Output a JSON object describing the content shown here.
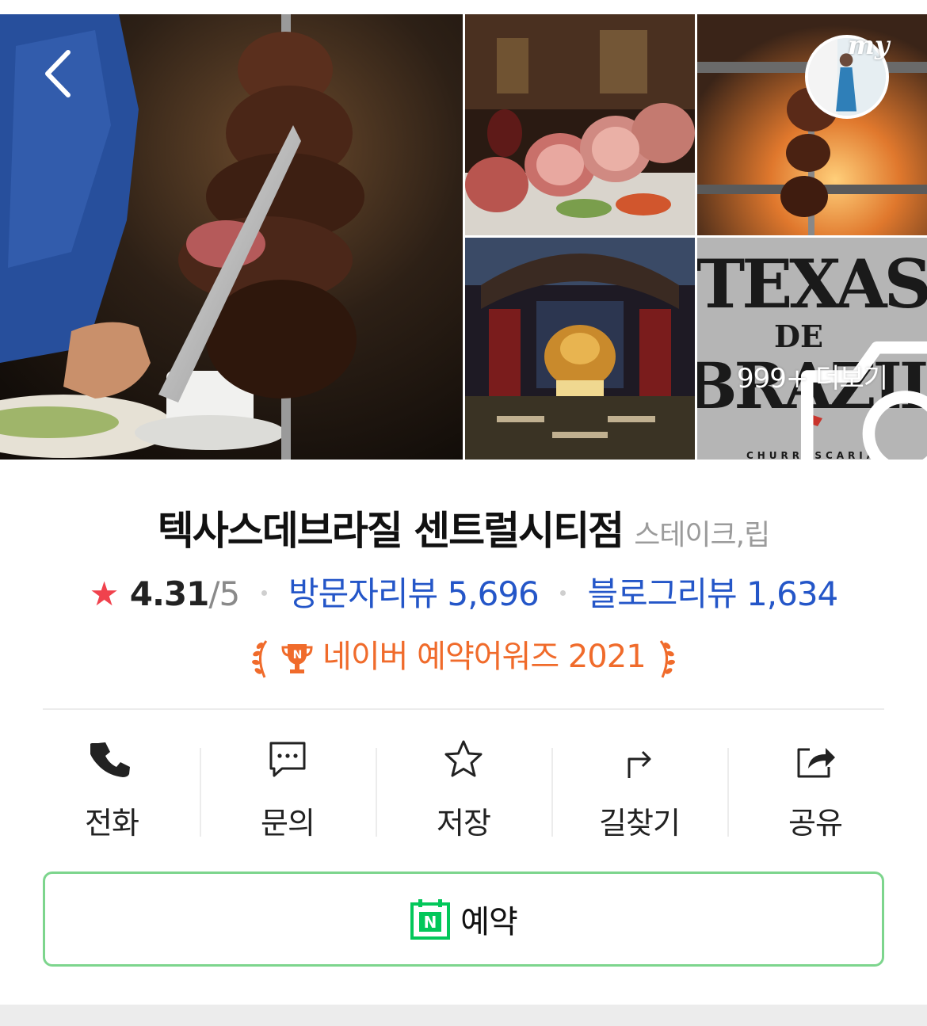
{
  "header": {
    "back_icon": "chevron-left-icon",
    "profile_badge": "my"
  },
  "gallery": {
    "more_label": "999+ 더보기",
    "more_icon": "camera-icon",
    "logo_text": [
      "TEXAS",
      "DE",
      "BRAZIL",
      "CHURRASCARIA"
    ]
  },
  "place": {
    "name": "텍사스데브라질 센트럴시티점",
    "category": "스테이크,립",
    "rating": "4.31",
    "rating_max": "/5",
    "visitor_reviews": "방문자리뷰 5,696",
    "blog_reviews": "블로그리뷰 1,634",
    "award": "네이버 예약어워즈 2021"
  },
  "actions": [
    {
      "label": "전화",
      "icon": "phone-icon"
    },
    {
      "label": "문의",
      "icon": "chat-icon"
    },
    {
      "label": "저장",
      "icon": "star-outline-icon"
    },
    {
      "label": "길찾기",
      "icon": "directions-icon"
    },
    {
      "label": "공유",
      "icon": "share-icon"
    }
  ],
  "reserve": {
    "label": "예약",
    "icon": "naver-booking-icon"
  },
  "colors": {
    "rating_star": "#f0424d",
    "link_blue": "#2456c8",
    "award_orange": "#f06b2b",
    "naver_green": "#03c75a",
    "reserve_border": "#7dd58d"
  }
}
